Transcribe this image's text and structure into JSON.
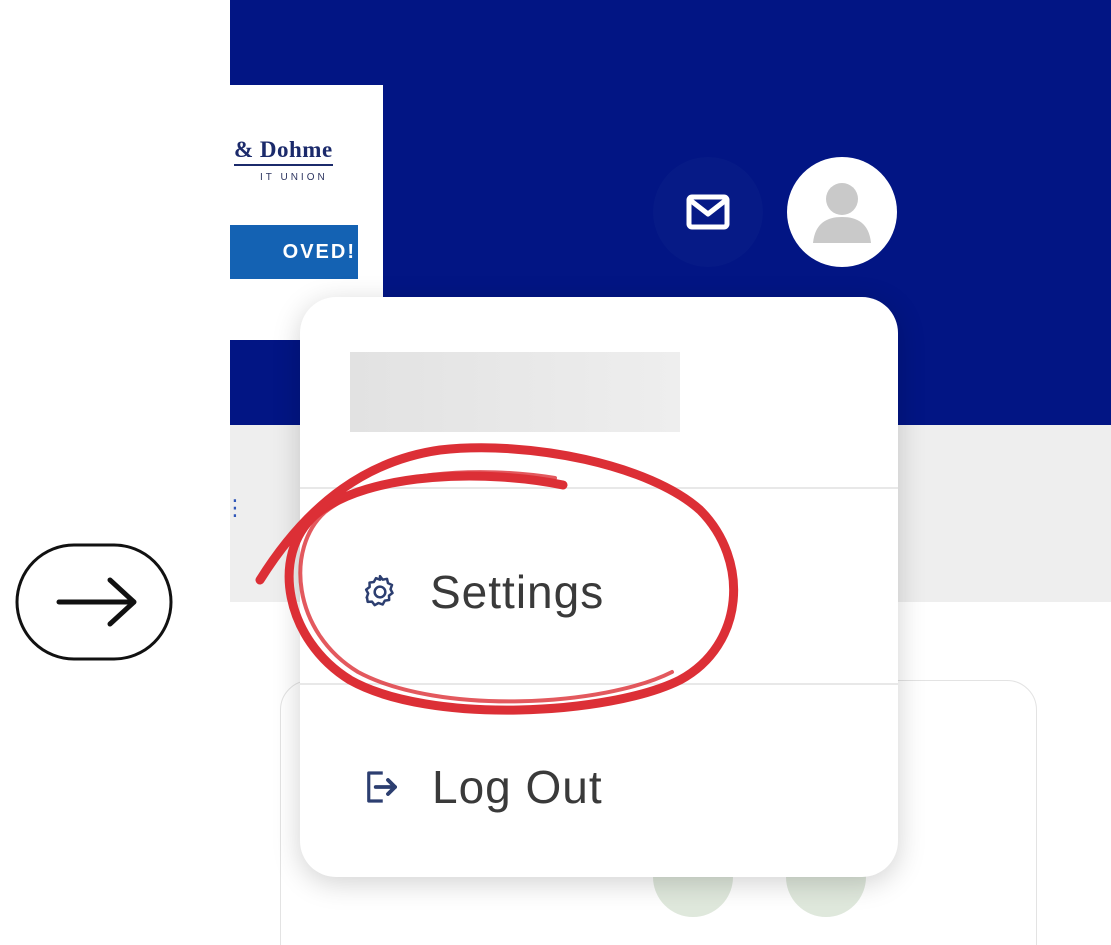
{
  "header": {
    "logo_name": "& Dohme",
    "logo_subtitle": "IT UNION",
    "promo_text": "OVED!"
  },
  "toolbar": {
    "mail_icon": "envelope-icon",
    "avatar_icon": "user-silhouette-icon"
  },
  "profile_menu": {
    "user_name": "",
    "items": [
      {
        "label": "Settings",
        "icon": "gear-icon"
      },
      {
        "label": "Log Out",
        "icon": "logout-icon"
      }
    ]
  },
  "annotation": {
    "pointer_icon": "arrow-right-circle-icon",
    "highlight_color": "#dc2f36"
  },
  "colors": {
    "header_bg": "#021584",
    "promo_bg": "#1462b3",
    "subnav_bg": "#eeeeee",
    "menu_text": "#3a3a3a",
    "icon_stroke": "#2c3e70"
  }
}
